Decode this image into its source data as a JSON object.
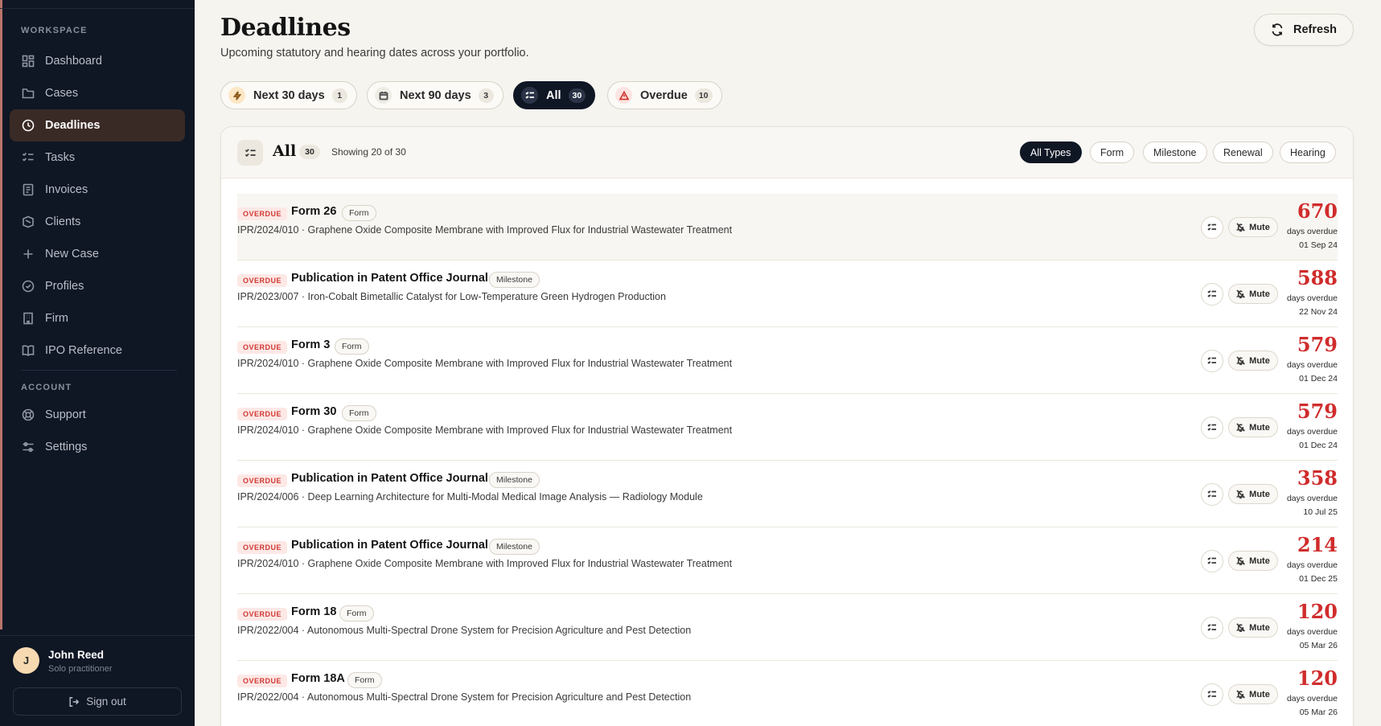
{
  "sidebar": {
    "workspace_label": "WORKSPACE",
    "account_label": "ACCOUNT",
    "items": [
      {
        "label": "Dashboard",
        "icon": "dashboard-icon"
      },
      {
        "label": "Cases",
        "icon": "folder-icon"
      },
      {
        "label": "Deadlines",
        "icon": "clock-icon",
        "active": true
      },
      {
        "label": "Tasks",
        "icon": "tasks-icon"
      },
      {
        "label": "Invoices",
        "icon": "invoice-icon"
      },
      {
        "label": "Clients",
        "icon": "users-icon"
      },
      {
        "label": "New Case",
        "icon": "plus-icon"
      },
      {
        "label": "Profiles",
        "icon": "check-circle-icon"
      },
      {
        "label": "Firm",
        "icon": "building-icon"
      },
      {
        "label": "IPO Reference",
        "icon": "book-icon"
      }
    ],
    "account_items": [
      {
        "label": "Support",
        "icon": "lifebuoy-icon"
      },
      {
        "label": "Settings",
        "icon": "sliders-icon"
      }
    ],
    "user": {
      "initial": "J",
      "name": "John Reed",
      "role": "Solo practitioner"
    },
    "sign_out_label": "Sign out"
  },
  "header": {
    "title": "Deadlines",
    "subtitle": "Upcoming statutory and hearing dates across your portfolio.",
    "refresh_label": "Refresh"
  },
  "tabs": [
    {
      "label": "Next 30 days",
      "count": "1",
      "icon": "lightning-icon"
    },
    {
      "label": "Next 90 days",
      "count": "3",
      "icon": "calendar-icon"
    },
    {
      "label": "All",
      "count": "30",
      "icon": "list-check-icon",
      "active": true
    },
    {
      "label": "Overdue",
      "count": "10",
      "icon": "warning-icon"
    }
  ],
  "panel": {
    "title": "All",
    "count": "30",
    "showing": "Showing 20 of 30",
    "type_filters": [
      "All Types",
      "Form",
      "Milestone",
      "Renewal",
      "Hearing"
    ],
    "active_filter": "All Types"
  },
  "rows": [
    {
      "status": "OVERDUE",
      "title": "Form 26",
      "type": "Form",
      "sub": "IPR/2024/010 · Graphene Oxide Composite Membrane with Improved Flux for Industrial Wastewater Treatment",
      "days": "670",
      "days_label": "days overdue",
      "date": "01 Sep 24",
      "mute": "Mute"
    },
    {
      "status": "OVERDUE",
      "title": "Publication in Patent Office Journal",
      "type": "Milestone",
      "sub": "IPR/2023/007 · Iron-Cobalt Bimetallic Catalyst for Low-Temperature Green Hydrogen Production",
      "days": "588",
      "days_label": "days overdue",
      "date": "22 Nov 24",
      "mute": "Mute"
    },
    {
      "status": "OVERDUE",
      "title": "Form 3",
      "type": "Form",
      "sub": "IPR/2024/010 · Graphene Oxide Composite Membrane with Improved Flux for Industrial Wastewater Treatment",
      "days": "579",
      "days_label": "days overdue",
      "date": "01 Dec 24",
      "mute": "Mute"
    },
    {
      "status": "OVERDUE",
      "title": "Form 30",
      "type": "Form",
      "sub": "IPR/2024/010 · Graphene Oxide Composite Membrane with Improved Flux for Industrial Wastewater Treatment",
      "days": "579",
      "days_label": "days overdue",
      "date": "01 Dec 24",
      "mute": "Mute"
    },
    {
      "status": "OVERDUE",
      "title": "Publication in Patent Office Journal",
      "type": "Milestone",
      "sub": "IPR/2024/006 · Deep Learning Architecture for Multi-Modal Medical Image Analysis — Radiology Module",
      "days": "358",
      "days_label": "days overdue",
      "date": "10 Jul 25",
      "mute": "Mute"
    },
    {
      "status": "OVERDUE",
      "title": "Publication in Patent Office Journal",
      "type": "Milestone",
      "sub": "IPR/2024/010 · Graphene Oxide Composite Membrane with Improved Flux for Industrial Wastewater Treatment",
      "days": "214",
      "days_label": "days overdue",
      "date": "01 Dec 25",
      "mute": "Mute"
    },
    {
      "status": "OVERDUE",
      "title": "Form 18",
      "type": "Form",
      "sub": "IPR/2022/004 · Autonomous Multi-Spectral Drone System for Precision Agriculture and Pest Detection",
      "days": "120",
      "days_label": "days overdue",
      "date": "05 Mar 26",
      "mute": "Mute"
    },
    {
      "status": "OVERDUE",
      "title": "Form 18A",
      "type": "Form",
      "sub": "IPR/2022/004 · Autonomous Multi-Spectral Drone System for Precision Agriculture and Pest Detection",
      "days": "120",
      "days_label": "days overdue",
      "date": "05 Mar 26",
      "mute": "Mute"
    }
  ],
  "colors": {
    "sidebar_bg": "#0f1624",
    "accent_active": "#3a2a25",
    "overdue_red": "#d02c2c",
    "page_bg": "#f6f4ef"
  }
}
